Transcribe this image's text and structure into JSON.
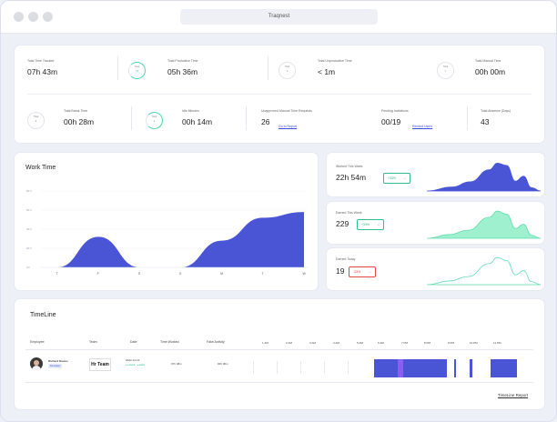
{
  "window": {
    "title": "Traqnest"
  },
  "stats": {
    "row1": [
      {
        "label": "Total Time Tracked",
        "value": "07h 43m"
      },
      {
        "label": "Total Productive Time",
        "value": "05h 36m",
        "ring_top": "Total",
        "ring_val": "73"
      },
      {
        "label": "Total Unproductive Time",
        "value": "< 1m",
        "ring_top": "Total",
        "ring_val": "2"
      },
      {
        "label": "Total Manual Time",
        "value": "00h 00m",
        "ring_top": "Total",
        "ring_val": "0"
      }
    ],
    "row2": [
      {
        "label": "Total Break Time",
        "value": "00h 28m",
        "ring_top": "Total",
        "ring_val": "6"
      },
      {
        "label": "Idle Minutes",
        "value": "00h 14m",
        "ring_top": "Total",
        "ring_val": "3"
      },
      {
        "label": "Unapproved Manual Time Requests",
        "value": "26",
        "link": "Go to Report"
      },
      {
        "label": "Pending Invitations",
        "value": "00/19",
        "link": "Remind Users"
      },
      {
        "label": "Total Absence (Days)",
        "value": "43"
      }
    ]
  },
  "work_time": {
    "title": "Work Time",
    "chart_data": {
      "type": "area",
      "categories": [
        "T",
        "F",
        "S",
        "S",
        "M",
        "T",
        "W"
      ],
      "values": [
        0,
        32,
        0,
        0,
        28,
        52,
        58
      ],
      "yticks": [
        "80 h",
        "60 h",
        "40 h",
        "20 h",
        "0 h"
      ],
      "ylim": [
        0,
        80
      ],
      "color": "#4a55d6"
    }
  },
  "mini": [
    {
      "label": "Worked This Week",
      "value": "22h 54m",
      "badge": "+33%",
      "badge_color": "#2ec08a",
      "fill": "#4a55d6",
      "stroke": "#4a55d6"
    },
    {
      "label": "Earned This Week",
      "value": "229",
      "badge": "+33%",
      "badge_color": "#2ec08a",
      "fill": "#9ff0cf",
      "stroke": "#5fdcad"
    },
    {
      "label": "Earned Today",
      "value": "19",
      "badge": "-33%",
      "badge_color": "#e04646",
      "fill": "#ffffff",
      "stroke": "#5fdcad"
    }
  ],
  "timeline": {
    "title": "TimeLine",
    "headers": [
      "Employee",
      "Team",
      "Date",
      "Time Worked",
      "Fake Activity"
    ],
    "times": [
      "1 AM",
      "2 AM",
      "3 AM",
      "4 AM",
      "5 AM",
      "6 AM",
      "7 PM",
      "8 PM",
      "9 PM",
      "10 PM",
      "11 PM"
    ],
    "row": {
      "name": "Richard Davies",
      "role": "Developer",
      "team": "Hr Team",
      "date": "2022-12-19",
      "date_sub1": "Lateral",
      "date_sub2": "Early",
      "worked": "07h 48m",
      "fake": "00h 00m"
    },
    "report_link": "TimeLine Report"
  },
  "colors": {
    "accent": "#4a55d6",
    "green": "#4cd9a3"
  }
}
